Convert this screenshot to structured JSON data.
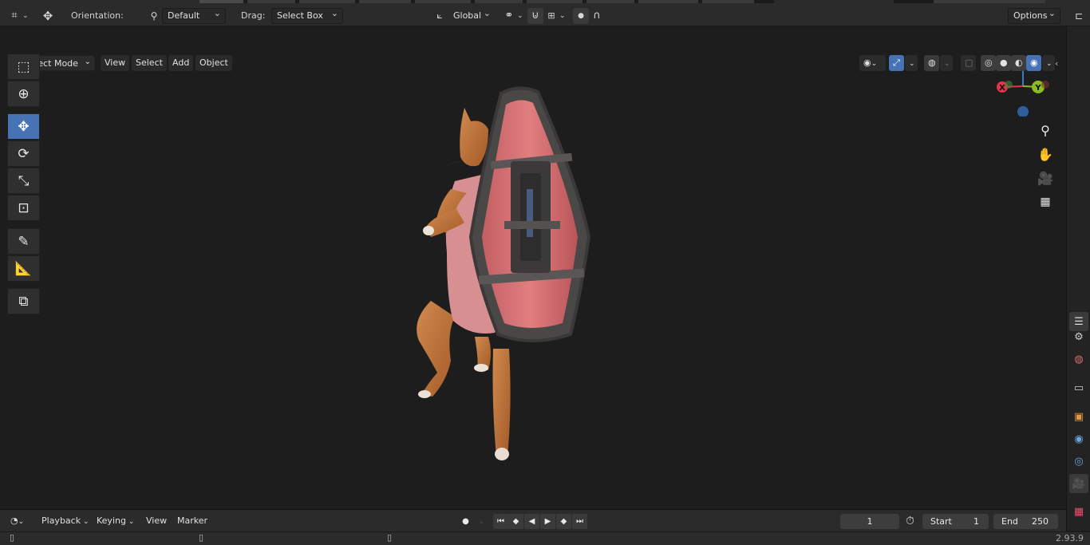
{
  "header": {
    "orientation_label": "Orientation:",
    "orientation_value": "Default",
    "drag_label": "Drag:",
    "drag_value": "Select Box",
    "transform_orientation": "Global",
    "options_label": "Options"
  },
  "viewport_header": {
    "mode": "Object Mode",
    "menus": [
      "View",
      "Select",
      "Add",
      "Object"
    ]
  },
  "toolbar": {
    "tools": [
      {
        "name": "select-box",
        "icon": "select-box-icon"
      },
      {
        "name": "cursor",
        "icon": "cursor-icon"
      },
      {
        "name": "move",
        "icon": "move-icon",
        "active": true
      },
      {
        "name": "rotate",
        "icon": "rotate-icon"
      },
      {
        "name": "scale",
        "icon": "scale-icon"
      },
      {
        "name": "transform",
        "icon": "transform-icon"
      },
      {
        "name": "annotate",
        "icon": "annotate-icon"
      },
      {
        "name": "measure",
        "icon": "measure-icon"
      },
      {
        "name": "add-cube",
        "icon": "add-cube-icon"
      }
    ]
  },
  "gizmo": {
    "axis_z": "Z",
    "axis_x": "X",
    "axis_y": "Y",
    "colors": {
      "x": "#e5334e",
      "y": "#8bbd23",
      "z": "#2d7fd0"
    }
  },
  "timeline": {
    "editor_menus": [
      "Playback",
      "Keying",
      "View",
      "Marker"
    ],
    "current_frame": "1",
    "start_label": "Start",
    "start_value": "1",
    "end_label": "End",
    "end_value": "250"
  },
  "status": {
    "version": "2.93.9"
  },
  "colors": {
    "accent": "#4772b3",
    "background": "#1d1d1d",
    "panel": "#2b2b2b"
  }
}
